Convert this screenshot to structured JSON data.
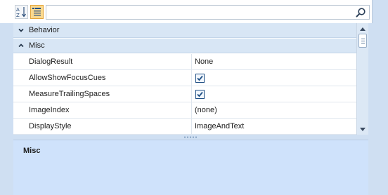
{
  "toolbar": {
    "sort_button": "alphabetical-sort",
    "category_button": "categorized-view",
    "search_value": ""
  },
  "categories": [
    {
      "label": "Behavior",
      "expanded": false
    },
    {
      "label": "Misc",
      "expanded": true
    }
  ],
  "properties": [
    {
      "name": "DialogResult",
      "value": "None",
      "type": "text"
    },
    {
      "name": "AllowShowFocusCues",
      "value": "",
      "type": "checkbox",
      "checked": true
    },
    {
      "name": "MeasureTrailingSpaces",
      "value": "",
      "type": "checkbox",
      "checked": true
    },
    {
      "name": "ImageIndex",
      "value": "(none)",
      "type": "text"
    },
    {
      "name": "DisplayStyle",
      "value": "ImageAndText",
      "type": "text"
    }
  ],
  "description": {
    "title": "Misc",
    "text": ""
  },
  "colors": {
    "category_bg": "#d8e6f5",
    "description_bg": "#cfe2fb",
    "selected_toolbar_button": "#fbd98e",
    "checkbox_border": "#1f4f85"
  }
}
